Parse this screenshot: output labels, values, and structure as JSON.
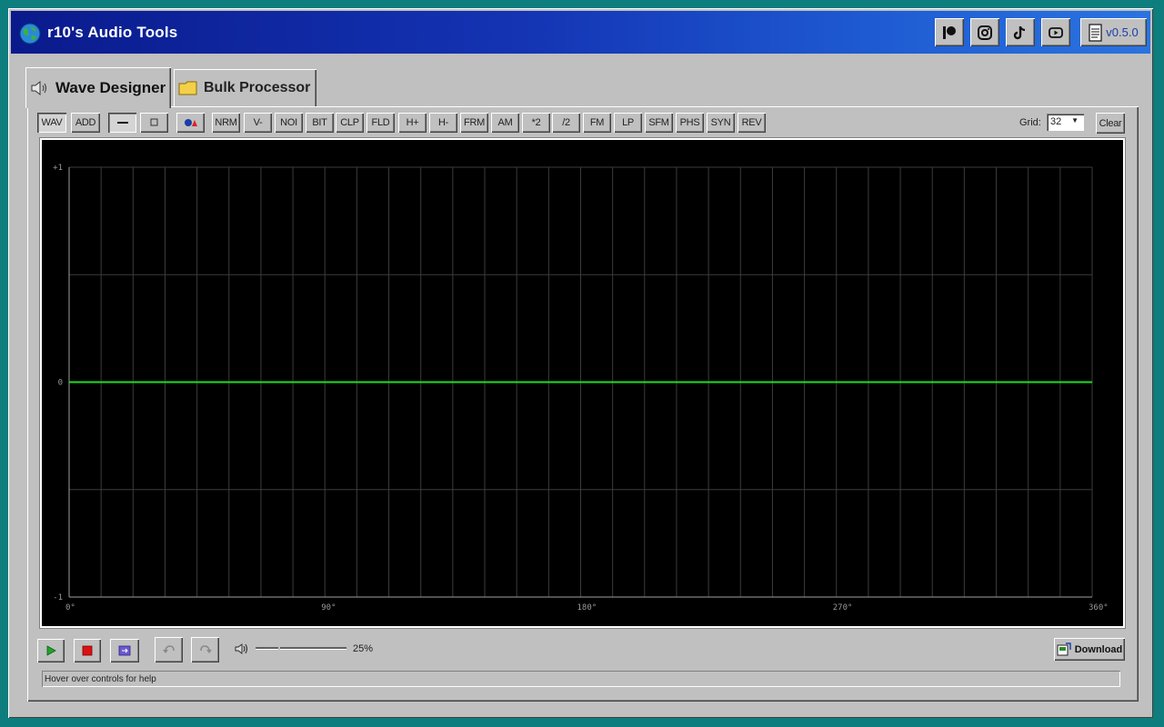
{
  "app": {
    "title": "r10's Audio Tools",
    "version": "v0.5.0",
    "social_icons": [
      "patreon-icon",
      "instagram-icon",
      "tiktok-icon",
      "youtube-icon"
    ]
  },
  "tabs": [
    {
      "label": "Wave Designer",
      "icon": "speaker-icon",
      "active": true
    },
    {
      "label": "Bulk Processor",
      "icon": "folder-icon",
      "active": false
    }
  ],
  "toolbar": {
    "mode_buttons": [
      {
        "label": "WAV",
        "pressed": true
      },
      {
        "label": "ADD",
        "pressed": false
      }
    ],
    "shape_buttons": [
      "line",
      "box",
      "shapes"
    ],
    "operations": [
      "NRM",
      "V-",
      "NOI",
      "BIT",
      "CLP",
      "FLD",
      "H+",
      "H-",
      "FRM",
      "AM",
      "*2",
      "/2",
      "FM",
      "LP",
      "SFM",
      "PHS",
      "SYN",
      "REV"
    ],
    "grid_label": "Grid:",
    "grid_value": "32",
    "clear_label": "Clear"
  },
  "canvas": {
    "y_labels": {
      "top": "+1",
      "mid": "0",
      "bottom": "-1"
    },
    "x_labels": [
      "0°",
      "90°",
      "180°",
      "270°",
      "360°"
    ],
    "waveform_value": 0,
    "vertical_divisions": 32,
    "background": "#000000",
    "wave_color": "#22dd22",
    "grid_color": "#3c3c3c"
  },
  "transport": {
    "play": "play-icon",
    "stop": "stop-icon",
    "loop": "loop-icon",
    "undo": "undo-icon",
    "redo": "redo-icon",
    "volume_percent": 25,
    "volume_text": "25%"
  },
  "download_label": "Download",
  "status_text": "Hover over controls for help"
}
